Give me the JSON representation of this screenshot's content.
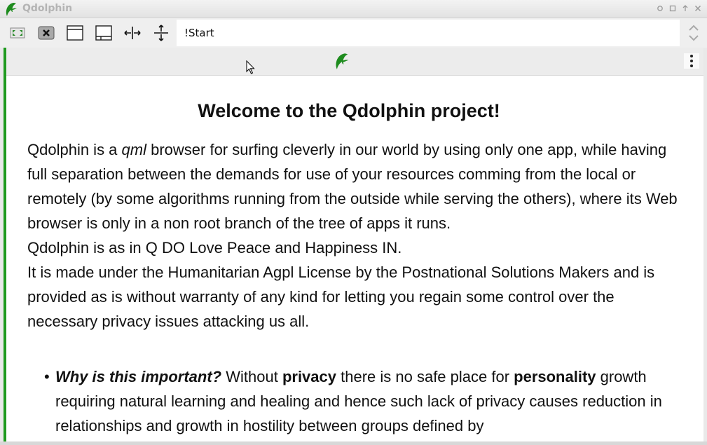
{
  "window": {
    "title": "Qdolphin",
    "controls": [
      "restore",
      "maximize",
      "up",
      "close"
    ]
  },
  "toolbar": {
    "buttons": [
      "fullscreen-icon",
      "close-tab-icon",
      "window-icon",
      "bottom-panel-icon",
      "horizontal-resize-icon",
      "vertical-resize-icon"
    ],
    "address_value": "!Start"
  },
  "page": {
    "heading": "Welcome to the Qdolphin project!",
    "p1_a": "Qdolphin is a ",
    "p1_em": "qml",
    "p1_b": " browser for surfing cleverly in our world by using only one app, while having full separation between the demands for use of your resources comming from the local or remotely (by some algorithms running from the outside while serving the others), where its Web browser is only in a non root branch of the tree of apps it runs.",
    "p2": "Qdolphin is as in Q DO Love Peace and Happiness IN.",
    "p3": "It is made under the Humanitarian Agpl License by the Postnational Solutions Makers and is provided as is without warranty of any kind for letting you regain some control over the necessary privacy issues attacking us all.",
    "bullet1_q": "Why is this important?",
    "bullet1_a": " Without ",
    "bullet1_b1": "privacy",
    "bullet1_c": " there is no safe place for ",
    "bullet1_b2": "personality",
    "bullet1_d": " growth requiring natural learning and healing and hence such lack of privacy causes reduction in relationships and growth in hostility between groups defined by"
  },
  "colors": {
    "accent": "#1f9a1f",
    "logo": "#1e8c1e"
  }
}
